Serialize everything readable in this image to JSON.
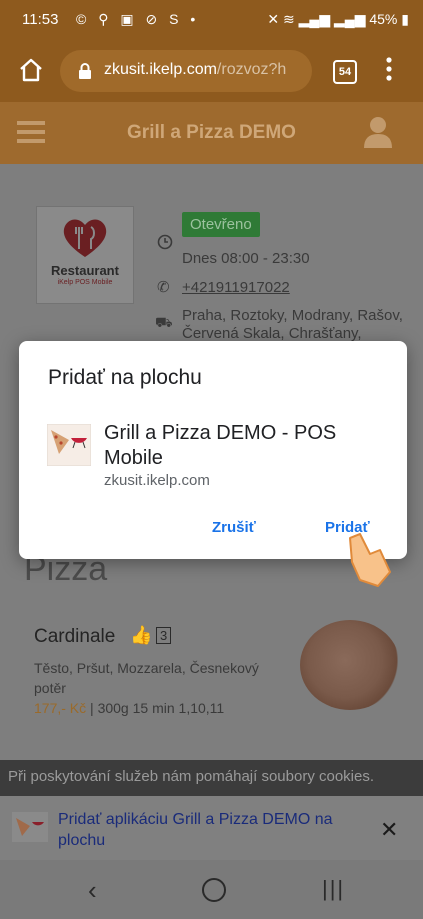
{
  "status_bar": {
    "time": "11:53",
    "battery": "45%",
    "network_right": "Vo) LTE1 .ıl Vo) LTE2 .ıl"
  },
  "browser": {
    "url_host": "zkusit.ikelp.com",
    "url_path": "/rozvoz?h",
    "tab_count": "54"
  },
  "app": {
    "title": "Grill a Pizza DEMO"
  },
  "restaurant": {
    "logo_text": "Restaurant",
    "logo_sub": "iKelp POS Mobile",
    "status": "Otevřeno",
    "hours": "Dnes 08:00 - 23:30",
    "phone": "+421911917022",
    "area_line1": "Praha, Roztoky, Modrany, Rašov,",
    "area_line2": "Červená Skala, Chrašťany,"
  },
  "menu": {
    "category": "Pizza",
    "item": {
      "name": "Cardinale",
      "likes": "3",
      "description": "Těsto, Pršut, Mozzarela, Česnekový potěr",
      "price": "177,- Kč",
      "weight": "300g",
      "time": "15 min",
      "allergens": "1,10,11"
    }
  },
  "cookie_bar": {
    "text": "Při poskytování služeb nám pomáhají soubory cookies."
  },
  "install_banner": {
    "text": "Pridať aplikáciu Grill a Pizza DEMO na plochu"
  },
  "dialog": {
    "title": "Pridať na plochu",
    "app_name": "Grill a Pizza DEMO - POS Mobile",
    "app_url": "zkusit.ikelp.com",
    "cancel_label": "Zrušiť",
    "add_label": "Pridať"
  },
  "colors": {
    "brand": "#9e6a2e",
    "accent": "#1a73e8",
    "open_badge": "#2f7a36"
  }
}
